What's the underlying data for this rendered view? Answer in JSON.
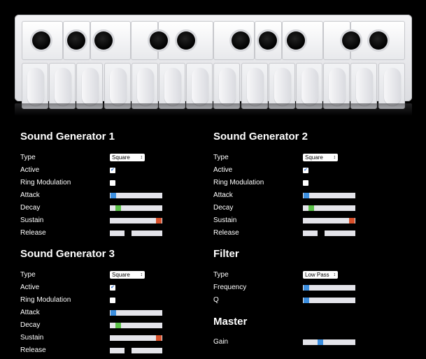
{
  "colors": {
    "background": "#000000",
    "thumb_blue": "#3c8fe0",
    "thumb_green": "#5ac048",
    "thumb_orange": "#d8502a",
    "track": "#e4e4ea"
  },
  "generators": [
    {
      "title": "Sound Generator 1",
      "type_label": "Type",
      "type_value": "Square",
      "active_label": "Active",
      "active": true,
      "ring_label": "Ring Modulation",
      "ring": false,
      "attack_label": "Attack",
      "attack": 0.02,
      "decay_label": "Decay",
      "decay": 0.12,
      "sustain_label": "Sustain",
      "sustain": 0.98,
      "release_label": "Release",
      "release": 0.33
    },
    {
      "title": "Sound Generator 2",
      "type_label": "Type",
      "type_value": "Square",
      "active_label": "Active",
      "active": true,
      "ring_label": "Ring Modulation",
      "ring": false,
      "attack_label": "Attack",
      "attack": 0.02,
      "decay_label": "Decay",
      "decay": 0.12,
      "sustain_label": "Sustain",
      "sustain": 0.98,
      "release_label": "Release",
      "release": 0.33
    },
    {
      "title": "Sound Generator 3",
      "type_label": "Type",
      "type_value": "Square",
      "active_label": "Active",
      "active": true,
      "ring_label": "Ring Modulation",
      "ring": false,
      "attack_label": "Attack",
      "attack": 0.02,
      "decay_label": "Decay",
      "decay": 0.12,
      "sustain_label": "Sustain",
      "sustain": 0.98,
      "release_label": "Release",
      "release": 0.33
    }
  ],
  "filter": {
    "title": "Filter",
    "type_label": "Type",
    "type_value": "Low Pass",
    "frequency_label": "Frequency",
    "frequency": 0.02,
    "q_label": "Q",
    "q": 0.02
  },
  "master": {
    "title": "Master",
    "gain_label": "Gain",
    "gain": 0.32
  },
  "select_arrow": "↕",
  "check_mark": "✔"
}
